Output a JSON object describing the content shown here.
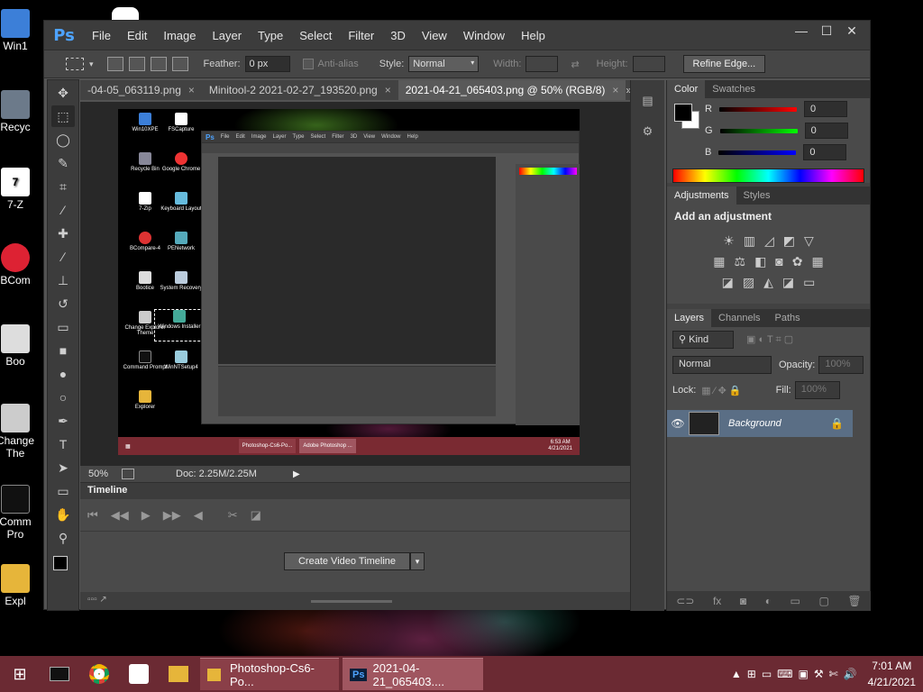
{
  "desktop": {
    "icons": [
      "Win1",
      "Recyc",
      "7-Z",
      "BCom",
      "Boo",
      "Change",
      "The",
      "Comm",
      "Pro",
      "Expl"
    ]
  },
  "ps": {
    "logo": "Ps",
    "menu": [
      "File",
      "Edit",
      "Image",
      "Layer",
      "Type",
      "Select",
      "Filter",
      "3D",
      "View",
      "Window",
      "Help"
    ],
    "window_btns": [
      "—",
      "☐",
      "✕"
    ],
    "options": {
      "feather_label": "Feather:",
      "feather_value": "0 px",
      "antialias_label": "Anti-alias",
      "style_label": "Style:",
      "style_value": "Normal",
      "width_label": "Width:",
      "height_label": "Height:",
      "refine_label": "Refine Edge..."
    },
    "tabs": [
      {
        "label": "-04-05_063119.png",
        "close": "×"
      },
      {
        "label": "Minitool-2  2021-02-27_193520.png",
        "close": "×"
      },
      {
        "label": "2021-04-21_065403.png @ 50% (RGB/8)",
        "close": "×"
      }
    ],
    "tabs_more": "»",
    "status": {
      "zoom": "50%",
      "doc": "Doc: 2.25M/2.25M"
    },
    "timeline": {
      "title": "Timeline",
      "create_label": "Create Video Timeline",
      "dropdown": "▾"
    },
    "color_panel": {
      "tabs": [
        "Color",
        "Swatches"
      ],
      "r_label": "R",
      "r_value": "0",
      "g_label": "G",
      "g_value": "0",
      "b_label": "B",
      "b_value": "0",
      "fg": "#000000",
      "bg": "#ffffff"
    },
    "adjustments_panel": {
      "tabs": [
        "Adjustments",
        "Styles"
      ],
      "title": "Add an adjustment"
    },
    "layers_panel": {
      "tabs": [
        "Layers",
        "Channels",
        "Paths"
      ],
      "kind_label": "Kind",
      "blend_mode": "Normal",
      "opacity_label": "Opacity:",
      "opacity_value": "100%",
      "lock_label": "Lock:",
      "fill_label": "Fill:",
      "fill_value": "100%",
      "layer_name": "Background"
    }
  },
  "mini_screenshot": {
    "icons": [
      "Win10XPE",
      "FSCapture",
      "Recycle Bin",
      "Google Chrome",
      "7-Zip",
      "Keyboard Layout",
      "BCompare-4",
      "PENetwork",
      "Bootice",
      "System Recovery",
      "Change Explorer Theme",
      "Windows Installer",
      "Command Prompt",
      "WinNTSetup4",
      "Explorer"
    ],
    "task1": "Photoshop-Cs6-Po...",
    "task2": "Adobe Photoshop ...",
    "time": "6:53 AM",
    "date": "4/21/2021"
  },
  "taskbar": {
    "task1": "Photoshop-Cs6-Po...",
    "task2": "2021-04-21_065403....",
    "task2_icon": "Ps",
    "time": "7:01 AM",
    "date": "4/21/2021"
  }
}
